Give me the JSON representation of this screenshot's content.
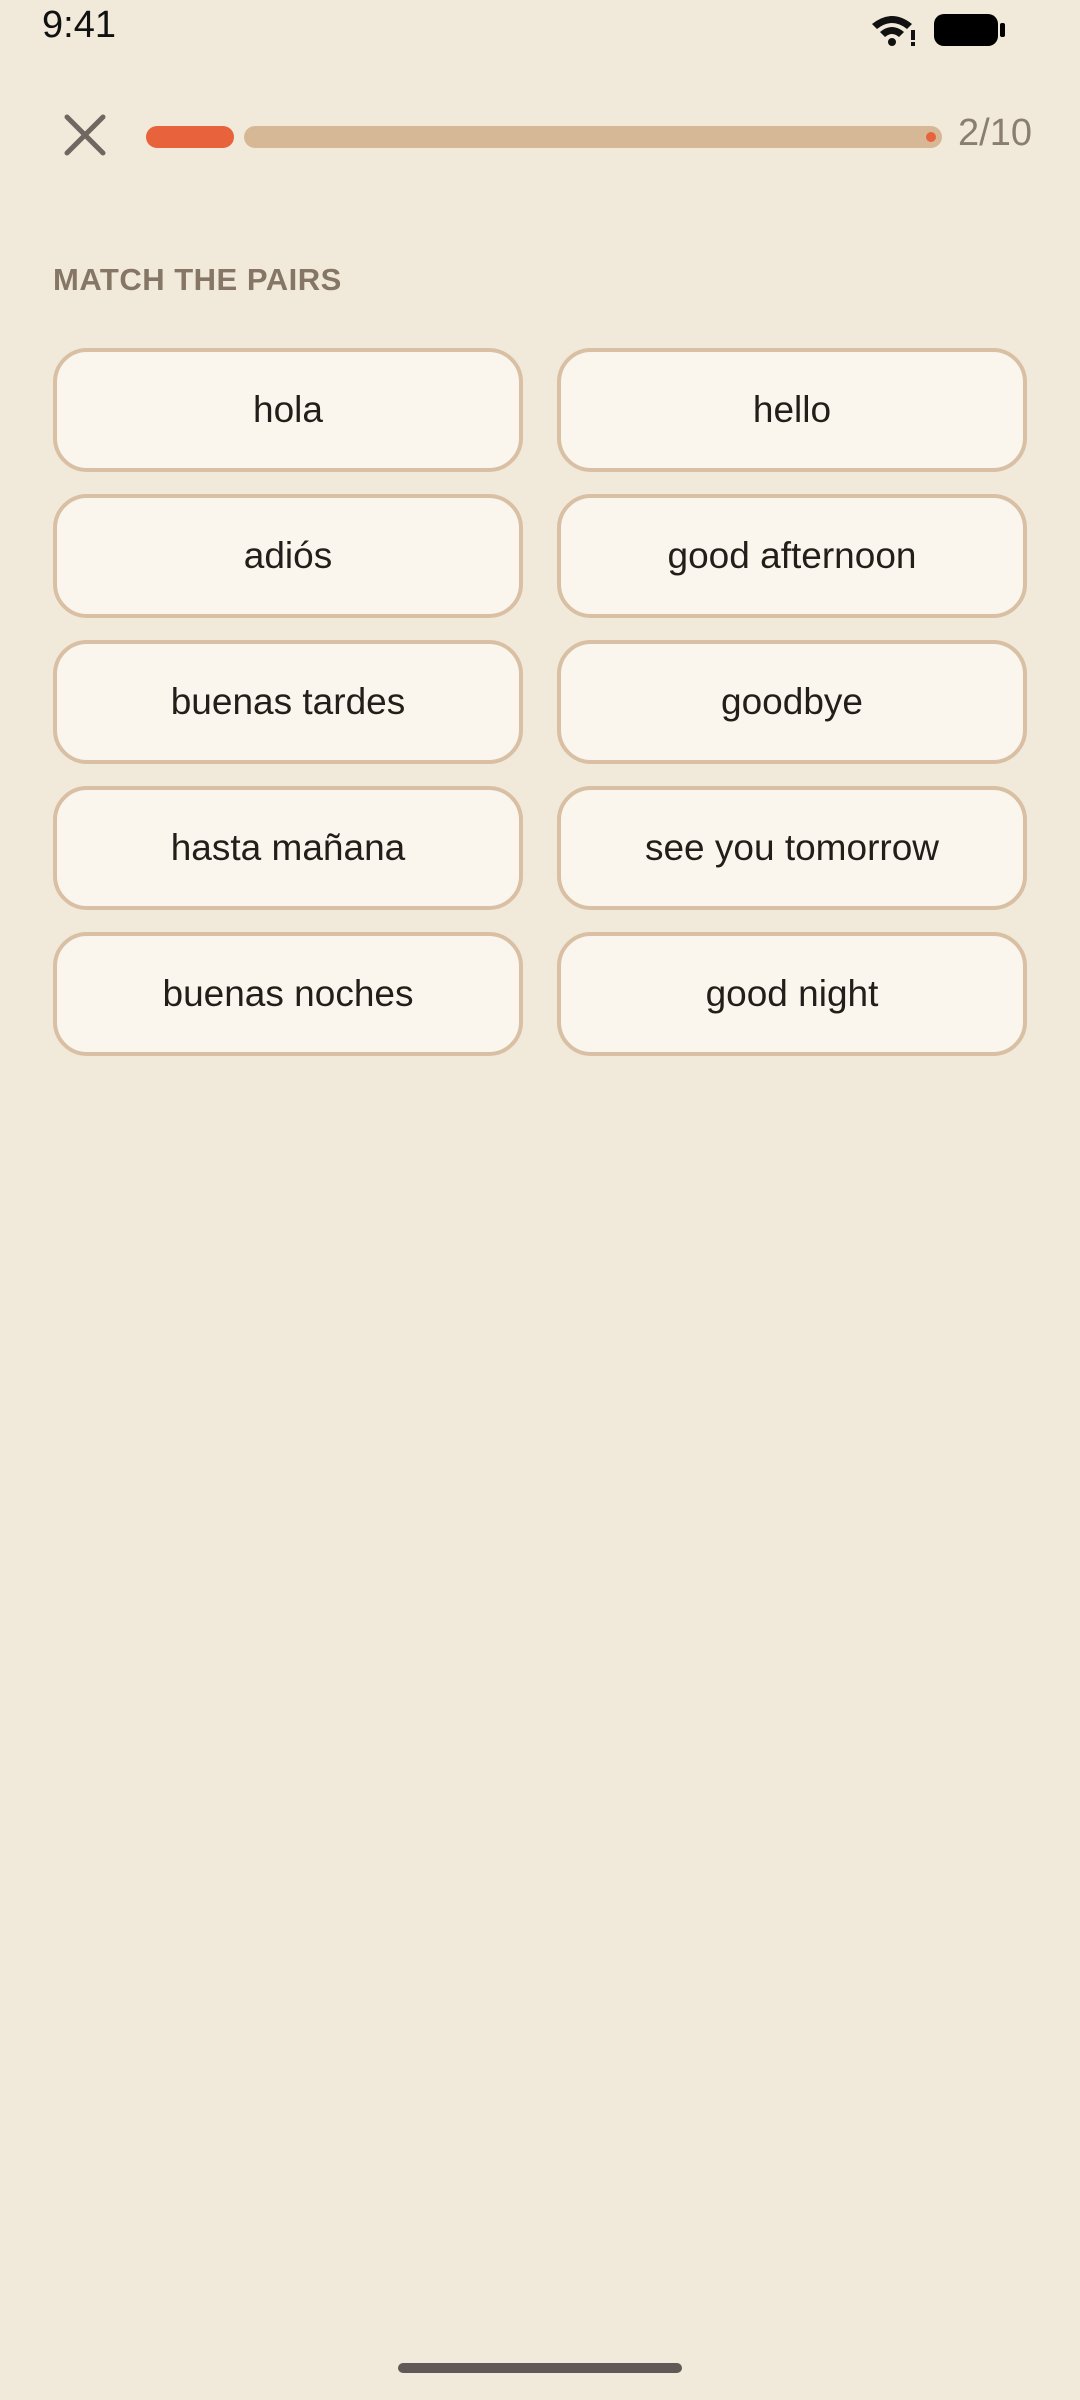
{
  "status_bar": {
    "time": "9:41",
    "wifi_icon": "wifi-alert-icon",
    "battery_icon": "battery-full-icon"
  },
  "header": {
    "close_icon": "close-icon",
    "progress": {
      "current": 2,
      "total": 10,
      "fill_fraction": 0.11,
      "counter_text": "2/10",
      "fill_color": "#e8623b",
      "track_color": "#d7b896"
    }
  },
  "prompt": {
    "title": "MATCH THE PAIRS"
  },
  "pairs": {
    "left": [
      "hola",
      "adiós",
      "buenas tardes",
      "hasta mañana",
      "buenas noches"
    ],
    "right": [
      "hello",
      "good afternoon",
      "goodbye",
      "see you tomorrow",
      "good night"
    ]
  },
  "colors": {
    "background": "#f1eadb",
    "tile_background": "#faf6ed",
    "tile_border": "#d9bfa3",
    "accent": "#e8623b"
  }
}
